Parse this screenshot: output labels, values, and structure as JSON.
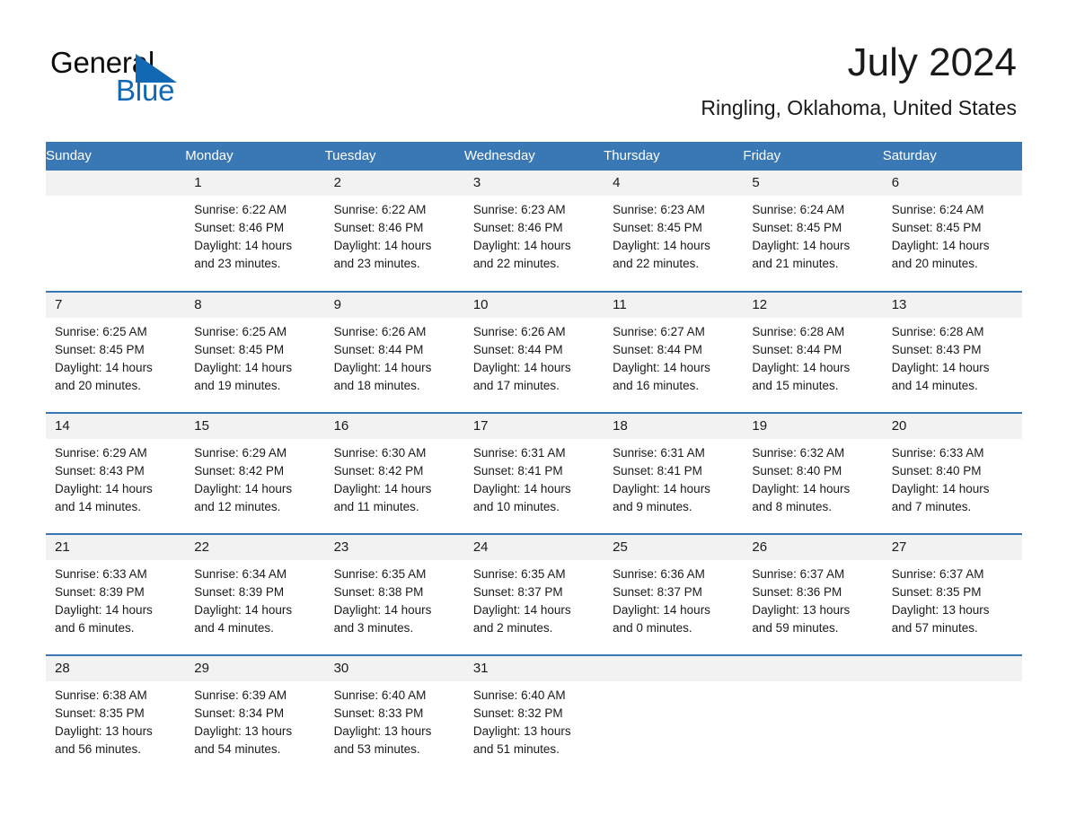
{
  "brand": {
    "logo_text_1": "General",
    "logo_text_2": "Blue",
    "logo_icon": "triangle-icon",
    "accent_color": "#1268b3"
  },
  "header": {
    "month_title": "July 2024",
    "location": "Ringling, Oklahoma, United States"
  },
  "calendar": {
    "header_bg": "#3a77b5",
    "daynum_bg": "#f2f2f2",
    "weekdays": [
      "Sunday",
      "Monday",
      "Tuesday",
      "Wednesday",
      "Thursday",
      "Friday",
      "Saturday"
    ],
    "weeks": [
      [
        {
          "day": "",
          "sunrise": "",
          "sunset": "",
          "daylight_1": "",
          "daylight_2": ""
        },
        {
          "day": "1",
          "sunrise": "Sunrise: 6:22 AM",
          "sunset": "Sunset: 8:46 PM",
          "daylight_1": "Daylight: 14 hours",
          "daylight_2": "and 23 minutes."
        },
        {
          "day": "2",
          "sunrise": "Sunrise: 6:22 AM",
          "sunset": "Sunset: 8:46 PM",
          "daylight_1": "Daylight: 14 hours",
          "daylight_2": "and 23 minutes."
        },
        {
          "day": "3",
          "sunrise": "Sunrise: 6:23 AM",
          "sunset": "Sunset: 8:46 PM",
          "daylight_1": "Daylight: 14 hours",
          "daylight_2": "and 22 minutes."
        },
        {
          "day": "4",
          "sunrise": "Sunrise: 6:23 AM",
          "sunset": "Sunset: 8:45 PM",
          "daylight_1": "Daylight: 14 hours",
          "daylight_2": "and 22 minutes."
        },
        {
          "day": "5",
          "sunrise": "Sunrise: 6:24 AM",
          "sunset": "Sunset: 8:45 PM",
          "daylight_1": "Daylight: 14 hours",
          "daylight_2": "and 21 minutes."
        },
        {
          "day": "6",
          "sunrise": "Sunrise: 6:24 AM",
          "sunset": "Sunset: 8:45 PM",
          "daylight_1": "Daylight: 14 hours",
          "daylight_2": "and 20 minutes."
        }
      ],
      [
        {
          "day": "7",
          "sunrise": "Sunrise: 6:25 AM",
          "sunset": "Sunset: 8:45 PM",
          "daylight_1": "Daylight: 14 hours",
          "daylight_2": "and 20 minutes."
        },
        {
          "day": "8",
          "sunrise": "Sunrise: 6:25 AM",
          "sunset": "Sunset: 8:45 PM",
          "daylight_1": "Daylight: 14 hours",
          "daylight_2": "and 19 minutes."
        },
        {
          "day": "9",
          "sunrise": "Sunrise: 6:26 AM",
          "sunset": "Sunset: 8:44 PM",
          "daylight_1": "Daylight: 14 hours",
          "daylight_2": "and 18 minutes."
        },
        {
          "day": "10",
          "sunrise": "Sunrise: 6:26 AM",
          "sunset": "Sunset: 8:44 PM",
          "daylight_1": "Daylight: 14 hours",
          "daylight_2": "and 17 minutes."
        },
        {
          "day": "11",
          "sunrise": "Sunrise: 6:27 AM",
          "sunset": "Sunset: 8:44 PM",
          "daylight_1": "Daylight: 14 hours",
          "daylight_2": "and 16 minutes."
        },
        {
          "day": "12",
          "sunrise": "Sunrise: 6:28 AM",
          "sunset": "Sunset: 8:44 PM",
          "daylight_1": "Daylight: 14 hours",
          "daylight_2": "and 15 minutes."
        },
        {
          "day": "13",
          "sunrise": "Sunrise: 6:28 AM",
          "sunset": "Sunset: 8:43 PM",
          "daylight_1": "Daylight: 14 hours",
          "daylight_2": "and 14 minutes."
        }
      ],
      [
        {
          "day": "14",
          "sunrise": "Sunrise: 6:29 AM",
          "sunset": "Sunset: 8:43 PM",
          "daylight_1": "Daylight: 14 hours",
          "daylight_2": "and 14 minutes."
        },
        {
          "day": "15",
          "sunrise": "Sunrise: 6:29 AM",
          "sunset": "Sunset: 8:42 PM",
          "daylight_1": "Daylight: 14 hours",
          "daylight_2": "and 12 minutes."
        },
        {
          "day": "16",
          "sunrise": "Sunrise: 6:30 AM",
          "sunset": "Sunset: 8:42 PM",
          "daylight_1": "Daylight: 14 hours",
          "daylight_2": "and 11 minutes."
        },
        {
          "day": "17",
          "sunrise": "Sunrise: 6:31 AM",
          "sunset": "Sunset: 8:41 PM",
          "daylight_1": "Daylight: 14 hours",
          "daylight_2": "and 10 minutes."
        },
        {
          "day": "18",
          "sunrise": "Sunrise: 6:31 AM",
          "sunset": "Sunset: 8:41 PM",
          "daylight_1": "Daylight: 14 hours",
          "daylight_2": "and 9 minutes."
        },
        {
          "day": "19",
          "sunrise": "Sunrise: 6:32 AM",
          "sunset": "Sunset: 8:40 PM",
          "daylight_1": "Daylight: 14 hours",
          "daylight_2": "and 8 minutes."
        },
        {
          "day": "20",
          "sunrise": "Sunrise: 6:33 AM",
          "sunset": "Sunset: 8:40 PM",
          "daylight_1": "Daylight: 14 hours",
          "daylight_2": "and 7 minutes."
        }
      ],
      [
        {
          "day": "21",
          "sunrise": "Sunrise: 6:33 AM",
          "sunset": "Sunset: 8:39 PM",
          "daylight_1": "Daylight: 14 hours",
          "daylight_2": "and 6 minutes."
        },
        {
          "day": "22",
          "sunrise": "Sunrise: 6:34 AM",
          "sunset": "Sunset: 8:39 PM",
          "daylight_1": "Daylight: 14 hours",
          "daylight_2": "and 4 minutes."
        },
        {
          "day": "23",
          "sunrise": "Sunrise: 6:35 AM",
          "sunset": "Sunset: 8:38 PM",
          "daylight_1": "Daylight: 14 hours",
          "daylight_2": "and 3 minutes."
        },
        {
          "day": "24",
          "sunrise": "Sunrise: 6:35 AM",
          "sunset": "Sunset: 8:37 PM",
          "daylight_1": "Daylight: 14 hours",
          "daylight_2": "and 2 minutes."
        },
        {
          "day": "25",
          "sunrise": "Sunrise: 6:36 AM",
          "sunset": "Sunset: 8:37 PM",
          "daylight_1": "Daylight: 14 hours",
          "daylight_2": "and 0 minutes."
        },
        {
          "day": "26",
          "sunrise": "Sunrise: 6:37 AM",
          "sunset": "Sunset: 8:36 PM",
          "daylight_1": "Daylight: 13 hours",
          "daylight_2": "and 59 minutes."
        },
        {
          "day": "27",
          "sunrise": "Sunrise: 6:37 AM",
          "sunset": "Sunset: 8:35 PM",
          "daylight_1": "Daylight: 13 hours",
          "daylight_2": "and 57 minutes."
        }
      ],
      [
        {
          "day": "28",
          "sunrise": "Sunrise: 6:38 AM",
          "sunset": "Sunset: 8:35 PM",
          "daylight_1": "Daylight: 13 hours",
          "daylight_2": "and 56 minutes."
        },
        {
          "day": "29",
          "sunrise": "Sunrise: 6:39 AM",
          "sunset": "Sunset: 8:34 PM",
          "daylight_1": "Daylight: 13 hours",
          "daylight_2": "and 54 minutes."
        },
        {
          "day": "30",
          "sunrise": "Sunrise: 6:40 AM",
          "sunset": "Sunset: 8:33 PM",
          "daylight_1": "Daylight: 13 hours",
          "daylight_2": "and 53 minutes."
        },
        {
          "day": "31",
          "sunrise": "Sunrise: 6:40 AM",
          "sunset": "Sunset: 8:32 PM",
          "daylight_1": "Daylight: 13 hours",
          "daylight_2": "and 51 minutes."
        },
        {
          "day": "",
          "sunrise": "",
          "sunset": "",
          "daylight_1": "",
          "daylight_2": ""
        },
        {
          "day": "",
          "sunrise": "",
          "sunset": "",
          "daylight_1": "",
          "daylight_2": ""
        },
        {
          "day": "",
          "sunrise": "",
          "sunset": "",
          "daylight_1": "",
          "daylight_2": ""
        }
      ]
    ]
  }
}
